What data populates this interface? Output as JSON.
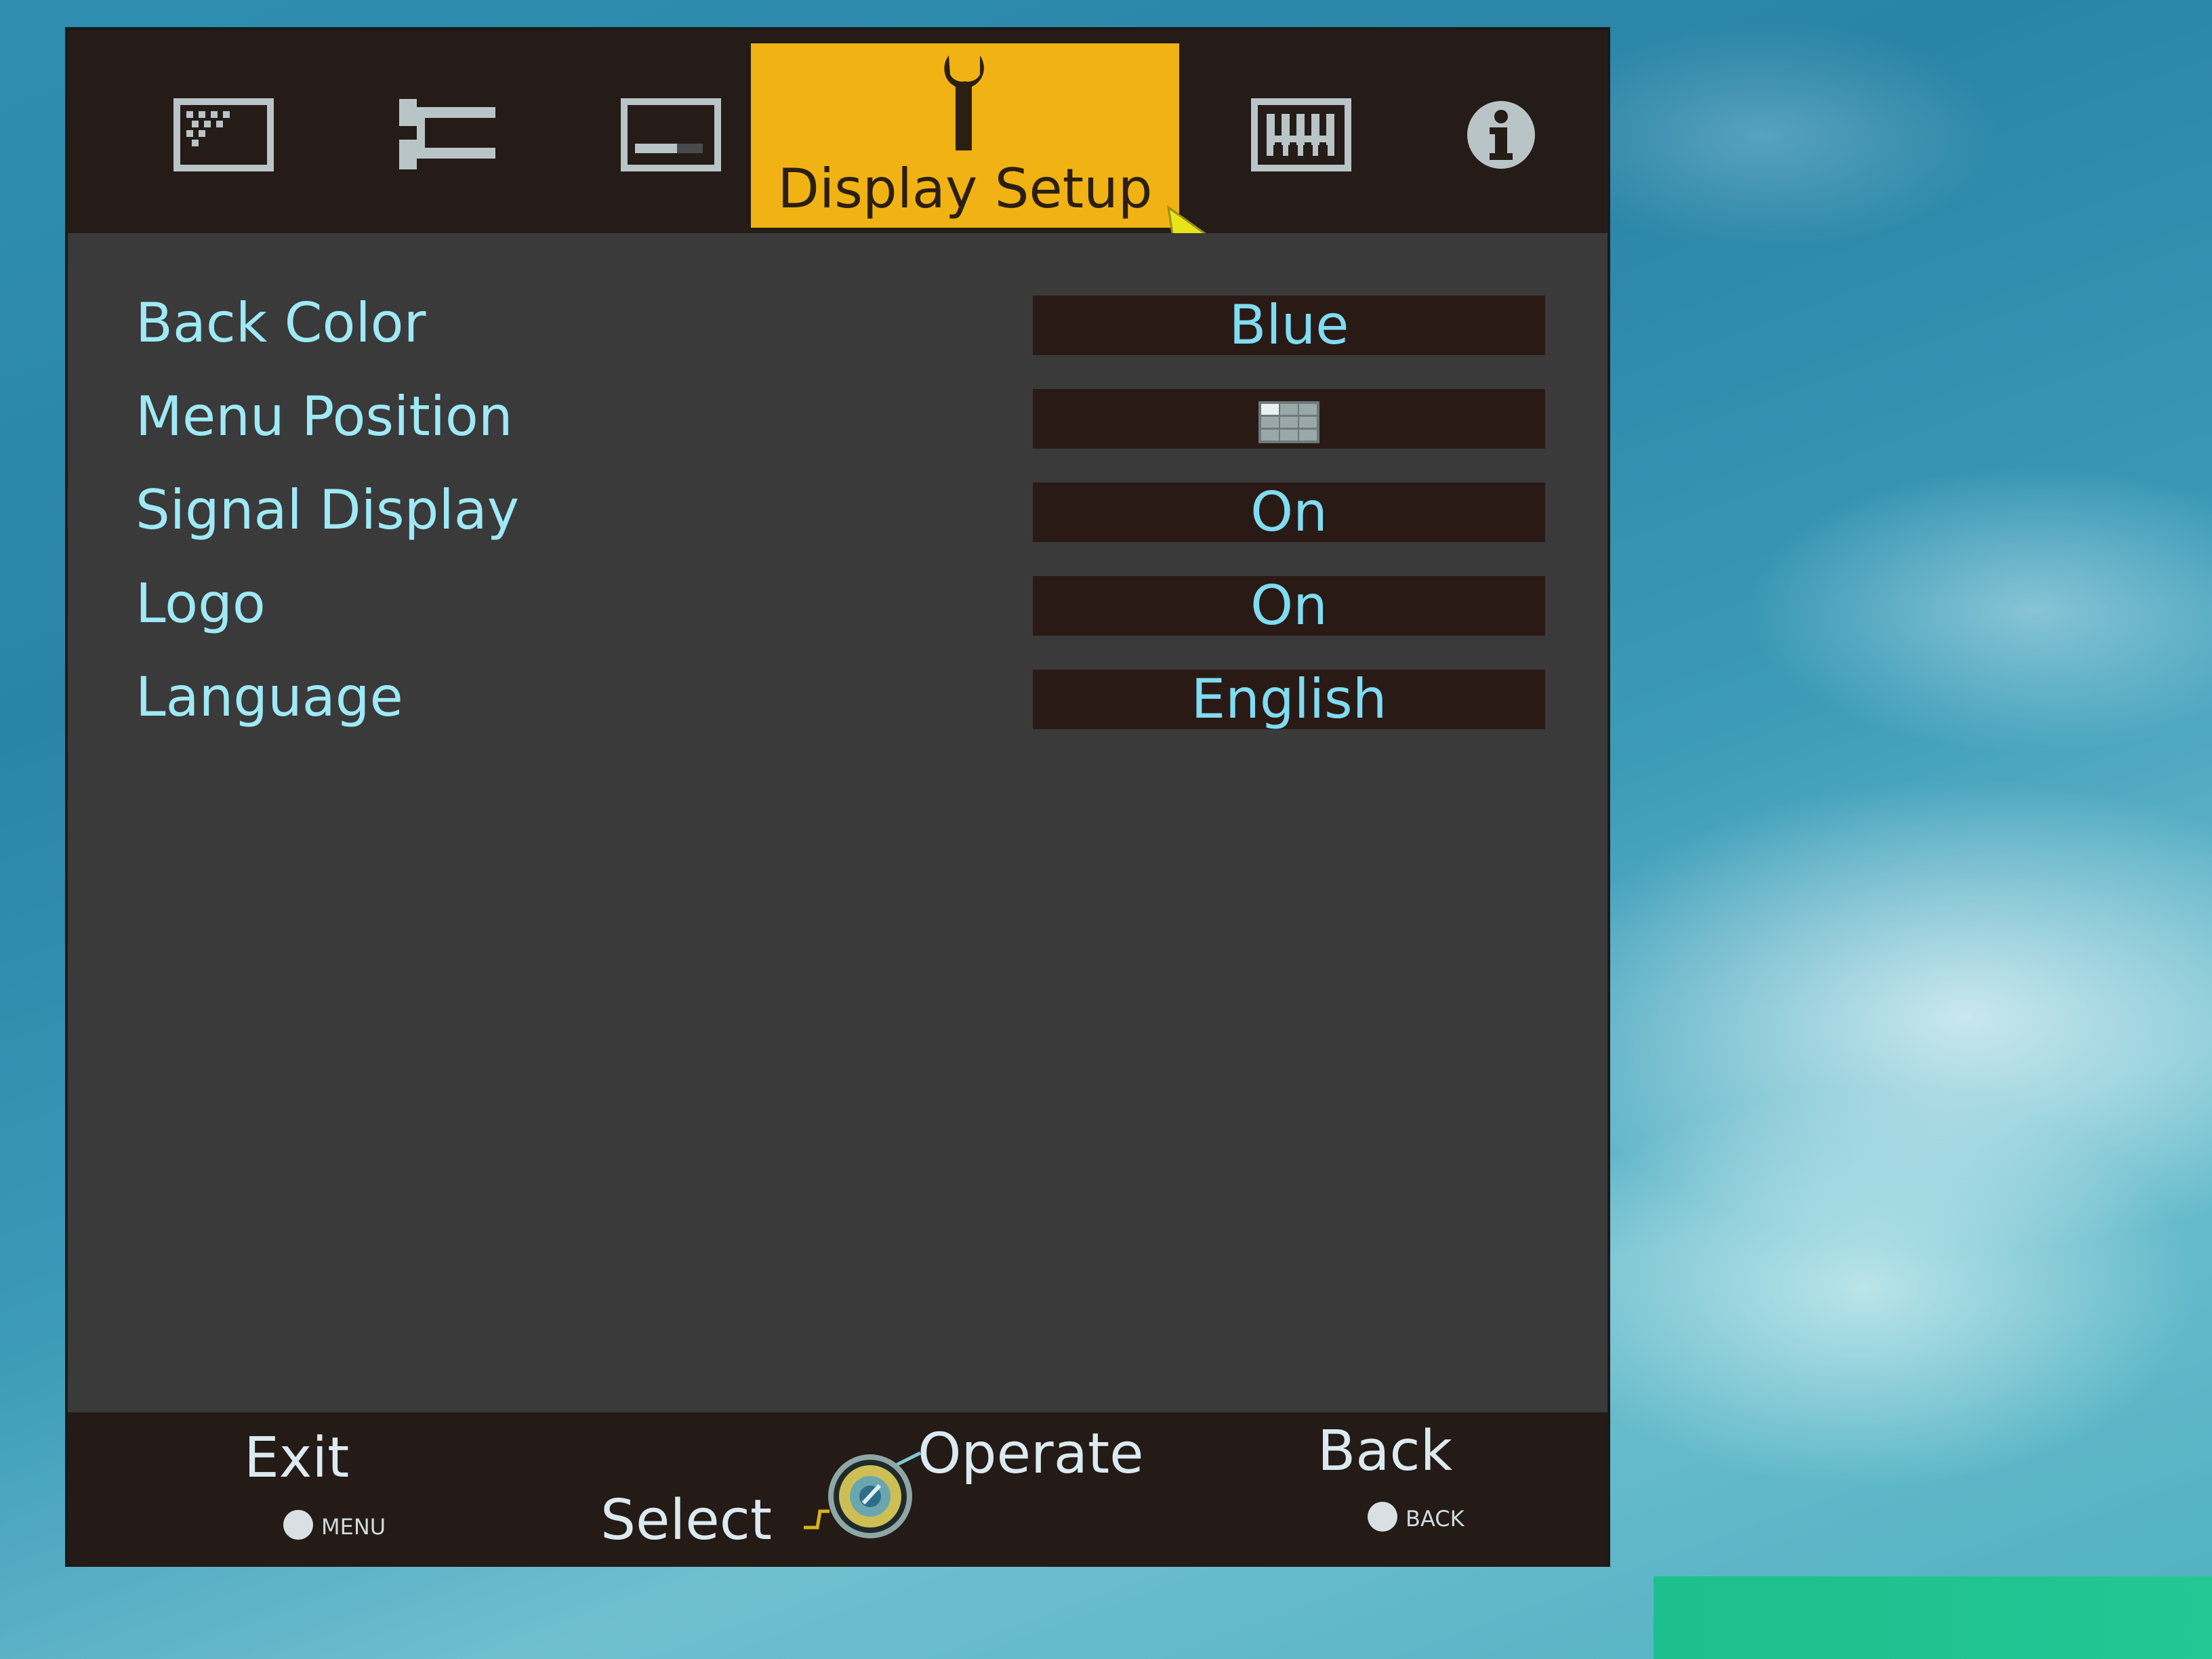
{
  "menu": {
    "tabs": [
      {
        "name": "picture-adjust-tab",
        "icon": "picture-icon",
        "label": ""
      },
      {
        "name": "input-settings-tab",
        "icon": "settings-tree-icon",
        "label": ""
      },
      {
        "name": "installation-tab",
        "icon": "screen-setup-icon",
        "label": ""
      },
      {
        "name": "display-setup-tab",
        "icon": "wrench-icon",
        "label": "Display Setup"
      },
      {
        "name": "function-tab",
        "icon": "keyboard-icon",
        "label": ""
      },
      {
        "name": "information-tab",
        "icon": "info-icon",
        "label": ""
      }
    ],
    "active_tab_index": 3
  },
  "settings": [
    {
      "label": "Back Color",
      "value": "Blue"
    },
    {
      "label": "Menu Position",
      "value": "",
      "value_icon": "menu-position-grid-icon"
    },
    {
      "label": "Signal Display",
      "value": "On"
    },
    {
      "label": "Logo",
      "value": "On"
    },
    {
      "label": "Language",
      "value": "English"
    }
  ],
  "footer": {
    "exit_label": "Exit",
    "exit_key": "MENU",
    "select_label": "Select",
    "operate_label": "Operate",
    "back_label": "Back",
    "back_key": "BACK"
  },
  "colors": {
    "active_tab": "#f1b313",
    "label_text": "#9fe9f6",
    "value_text": "#7fdcf2",
    "panel_bg": "#3a3a3b",
    "bar_bg": "#251b17"
  }
}
